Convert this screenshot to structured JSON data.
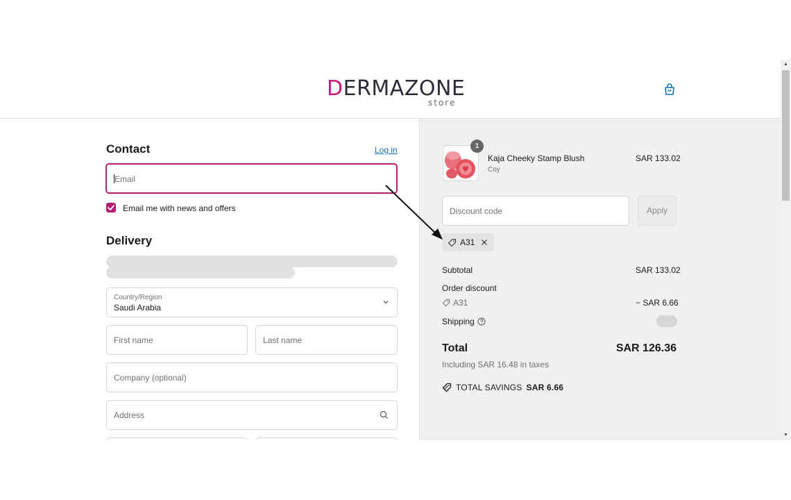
{
  "header": {
    "logo_text": "ERMAZONE",
    "logo_sub": "store",
    "cart_icon": "shopping-bag-icon"
  },
  "contact": {
    "heading": "Contact",
    "login_link": "Log in",
    "email_placeholder": "Email",
    "newsletter_label": "Email me with news and offers",
    "newsletter_checked": true
  },
  "delivery": {
    "heading": "Delivery",
    "country_label": "Country/Region",
    "country_value": "Saudi Arabia",
    "first_name_placeholder": "First name",
    "last_name_placeholder": "Last name",
    "company_placeholder": "Company (optional)",
    "address_placeholder": "Address"
  },
  "summary": {
    "item": {
      "quantity": "1",
      "name": "Kaja Cheeky Stamp Blush",
      "variant": "Coy",
      "price": "SAR 133.02"
    },
    "discount_placeholder": "Discount code",
    "apply_label": "Apply",
    "applied_code": "A31",
    "subtotal_label": "Subtotal",
    "subtotal_value": "SAR 133.02",
    "order_discount_label": "Order discount",
    "discount_code_line": "A31",
    "discount_value": "− SAR 6.66",
    "shipping_label": "Shipping",
    "total_label": "Total",
    "total_value": "SAR 126.36",
    "tax_note": "Including SAR 16.48 in taxes",
    "savings_label": "TOTAL SAVINGS",
    "savings_value": "SAR 6.66"
  },
  "colors": {
    "brand": "#c8197e",
    "focus_border": "#b21e72",
    "link": "#1773b0",
    "summary_bg": "#f0f0f0"
  }
}
